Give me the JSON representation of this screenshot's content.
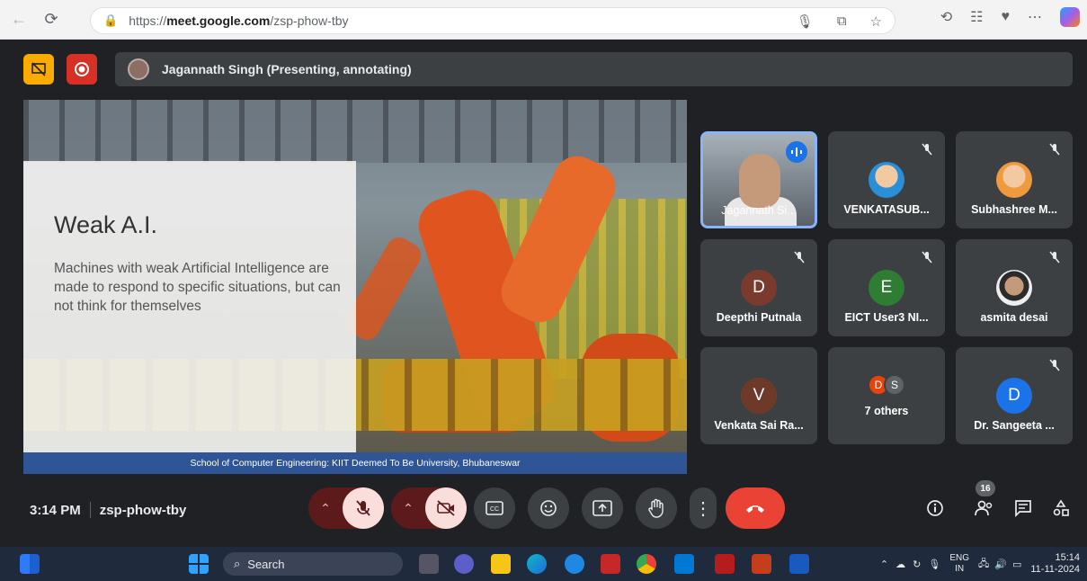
{
  "browser": {
    "url_scheme": "https://",
    "url_host": "meet.google.com",
    "url_path": "/zsp-phow-tby"
  },
  "banner": {
    "presenter_text": "Jagannath Singh (Presenting, annotating)"
  },
  "slide": {
    "title": "Weak A.I.",
    "body": "Machines with weak Artificial Intelligence are made to respond to specific situations, but can not think for themselves",
    "footer": "School of Computer Engineering: KIIT Deemed To Be University, Bhubaneswar"
  },
  "participants": [
    {
      "name": "Jagannath Si...",
      "initial": "",
      "color": "",
      "muted": false,
      "speaking": true
    },
    {
      "name": "VENKATASUB...",
      "initial": "",
      "color": "#2a8fd6",
      "muted": true
    },
    {
      "name": "Subhashree M...",
      "initial": "",
      "color": "#2a8fd6",
      "muted": true
    },
    {
      "name": "Deepthi Putnala",
      "initial": "D",
      "color": "#7a3b2e",
      "muted": true
    },
    {
      "name": "EICT User3 NI...",
      "initial": "E",
      "color": "#2e7d32",
      "muted": true
    },
    {
      "name": "asmita desai",
      "initial": "",
      "color": "#ddd",
      "muted": true
    },
    {
      "name": "Venkata Sai Ra...",
      "initial": "V",
      "color": "#6d3a2a",
      "muted": false
    },
    {
      "name": "7 others",
      "initial": "",
      "color": "",
      "muted": false,
      "others": [
        "D",
        "S"
      ]
    },
    {
      "name": "Dr. Sangeeta ...",
      "initial": "D",
      "color": "#1a73e8",
      "muted": true
    }
  ],
  "meeting": {
    "time": "3:14 PM",
    "code": "zsp-phow-tby",
    "participant_count": "16"
  },
  "taskbar": {
    "search_label": "Search",
    "lang_top": "ENG",
    "lang_bottom": "IN",
    "clock_time": "15:14",
    "clock_date": "11-11-2024"
  },
  "colors": {
    "end_call": "#ea4335",
    "active_border": "#8ab4f8",
    "slide_footer": "#2f5597"
  }
}
